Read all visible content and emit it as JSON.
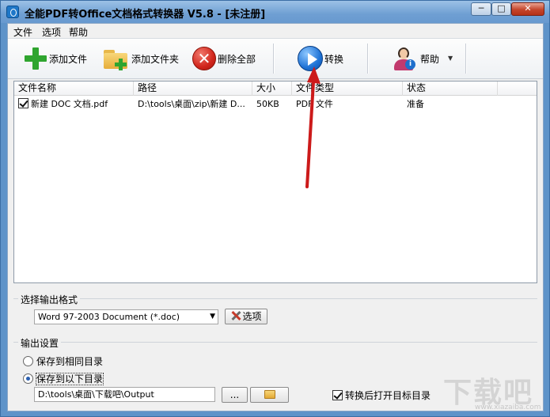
{
  "window": {
    "title": "全能PDF转Office文档格式转换器 V5.8  -  [未注册]",
    "controls": {
      "minimize": "─",
      "maximize": "□",
      "close": "✕"
    }
  },
  "menu": [
    "文件",
    "选项",
    "帮助"
  ],
  "toolbar": {
    "add_file": "添加文件",
    "add_folder": "添加文件夹",
    "delete_all": "删除全部",
    "convert": "转换",
    "help": "帮助"
  },
  "file_list": {
    "columns": [
      "文件名称",
      "路径",
      "大小",
      "文件类型",
      "状态"
    ],
    "rows": [
      {
        "checked": true,
        "name": "新建 DOC 文档.pdf",
        "path": "D:\\tools\\桌面\\zip\\新建 D...",
        "size": "50KB",
        "type": "PDF 文件",
        "status": "准备"
      }
    ]
  },
  "output_format": {
    "group_label": "选择输出格式",
    "selected": "Word 97-2003 Document (*.doc)",
    "options_button": "选项"
  },
  "output_settings": {
    "group_label": "输出设置",
    "radio_same_dir": "保存到相同目录",
    "radio_custom_dir": "保存到以下目录",
    "selected_radio": "custom",
    "path_value": "D:\\tools\\桌面\\下载吧\\Output",
    "browse_button": "...",
    "open_after_label": "转换后打开目标目录",
    "open_after_checked": true
  },
  "watermark": {
    "text": "下载吧",
    "sub": "www.xiazaiba.com"
  },
  "colors": {
    "title_bar": "#6f9fd3",
    "accent": "#1f73d6",
    "annotation_arrow": "#cc1a1a"
  }
}
